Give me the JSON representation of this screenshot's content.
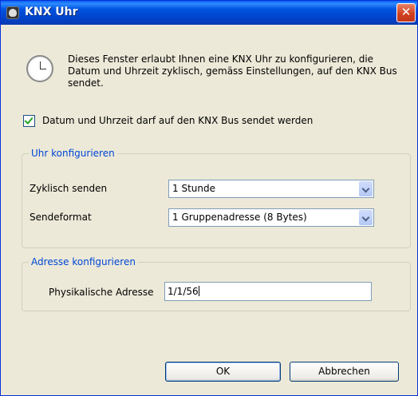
{
  "window": {
    "title": "KNX Uhr",
    "close_label": "✕"
  },
  "description": "Dieses Fenster erlaubt Ihnen eine KNX Uhr zu konfigurieren, die Datum und Uhrzeit zyklisch, gemäss Einstellungen, auf den KNX Bus sendet.",
  "send_checkbox": {
    "label": "Datum und Uhrzeit darf auf den KNX Bus sendet werden",
    "checked": true
  },
  "clock_group": {
    "title": "Uhr konfigurieren",
    "cyclic_label": "Zyklisch senden",
    "cyclic_value": "1 Stunde",
    "format_label": "Sendeformat",
    "format_value": "1 Gruppenadresse (8 Bytes)"
  },
  "address_group": {
    "title": "Adresse konfigurieren",
    "physical_label": "Physikalische Adresse",
    "physical_value": "1/1/56"
  },
  "buttons": {
    "ok": "OK",
    "cancel": "Abbrechen"
  },
  "icons": {
    "title": "knx-app-icon",
    "info": "clock-icon",
    "close": "close-icon"
  },
  "colors": {
    "title_bar": "#0053e1",
    "close_button": "#d0421f",
    "group_title": "#0046d5",
    "checkmark": "#21a121"
  }
}
